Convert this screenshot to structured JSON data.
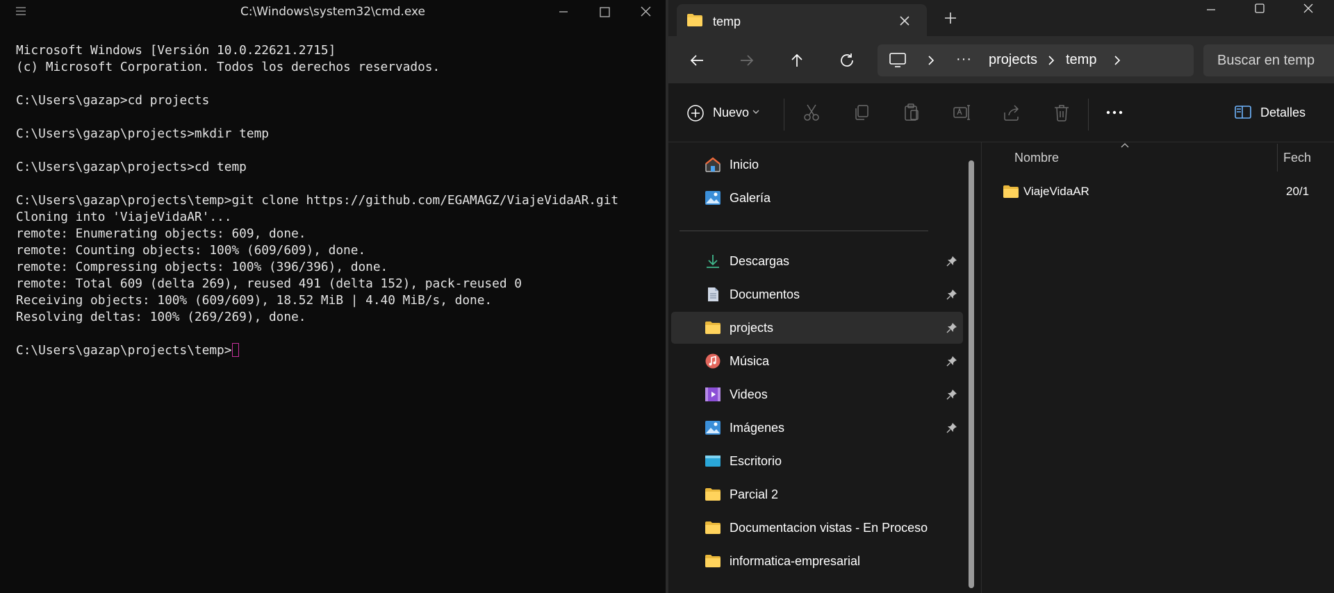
{
  "cmd": {
    "title": "C:\\Windows\\system32\\cmd.exe",
    "lines": [
      "Microsoft Windows [Versión 10.0.22621.2715]",
      "(c) Microsoft Corporation. Todos los derechos reservados.",
      "",
      "C:\\Users\\gazap>cd projects",
      "",
      "C:\\Users\\gazap\\projects>mkdir temp",
      "",
      "C:\\Users\\gazap\\projects>cd temp",
      "",
      "C:\\Users\\gazap\\projects\\temp>git clone https://github.com/EGAMAGZ/ViajeVidaAR.git",
      "Cloning into 'ViajeVidaAR'...",
      "remote: Enumerating objects: 609, done.",
      "remote: Counting objects: 100% (609/609), done.",
      "remote: Compressing objects: 100% (396/396), done.",
      "remote: Total 609 (delta 269), reused 491 (delta 152), pack-reused 0",
      "Receiving objects: 100% (609/609), 18.52 MiB | 4.40 MiB/s, done.",
      "Resolving deltas: 100% (269/269), done.",
      "",
      "C:\\Users\\gazap\\projects\\temp>"
    ],
    "colors": {
      "background": "#0c0c0c",
      "text": "#e4e4e4",
      "cursor": "#c7319d"
    }
  },
  "explorer": {
    "tab": {
      "title": "temp",
      "icon": "folder-icon"
    },
    "address": {
      "segments": [
        "projects",
        "temp"
      ],
      "overflow": "···"
    },
    "search": {
      "placeholder": "Buscar en temp"
    },
    "toolbar": {
      "new_label": "Nuevo",
      "details_label": "Detalles",
      "icons": [
        "cut-icon",
        "copy-icon",
        "paste-icon",
        "rename-icon",
        "share-icon",
        "delete-icon",
        "more-icon"
      ]
    },
    "sidebar": {
      "top_items": [
        {
          "label": "Inicio",
          "icon": "home-icon"
        },
        {
          "label": "Galería",
          "icon": "gallery-icon"
        }
      ],
      "pinned_items": [
        {
          "label": "Descargas",
          "icon": "download-icon",
          "pinned": true
        },
        {
          "label": "Documentos",
          "icon": "document-icon",
          "pinned": true
        },
        {
          "label": "projects",
          "icon": "folder-icon",
          "pinned": true,
          "selected": true
        },
        {
          "label": "Música",
          "icon": "music-icon",
          "pinned": true
        },
        {
          "label": "Videos",
          "icon": "video-icon",
          "pinned": true
        },
        {
          "label": "Imágenes",
          "icon": "pictures-icon",
          "pinned": true
        },
        {
          "label": "Escritorio",
          "icon": "desktop-icon",
          "pinned": false
        },
        {
          "label": "Parcial 2",
          "icon": "folder-icon",
          "pinned": false
        },
        {
          "label": "Documentacion vistas - En Proceso",
          "icon": "folder-icon",
          "pinned": false
        },
        {
          "label": "informatica-empresarial",
          "icon": "folder-icon",
          "pinned": false
        }
      ]
    },
    "columns": {
      "name": "Nombre",
      "date": "Fech"
    },
    "files": [
      {
        "name": "ViajeVidaAR",
        "date": "20/1",
        "icon": "folder-icon"
      }
    ],
    "colors": {
      "background": "#191919",
      "bar": "#2c2c2c",
      "folder": "#f3c54a",
      "selected": "#2d2d2d"
    }
  }
}
